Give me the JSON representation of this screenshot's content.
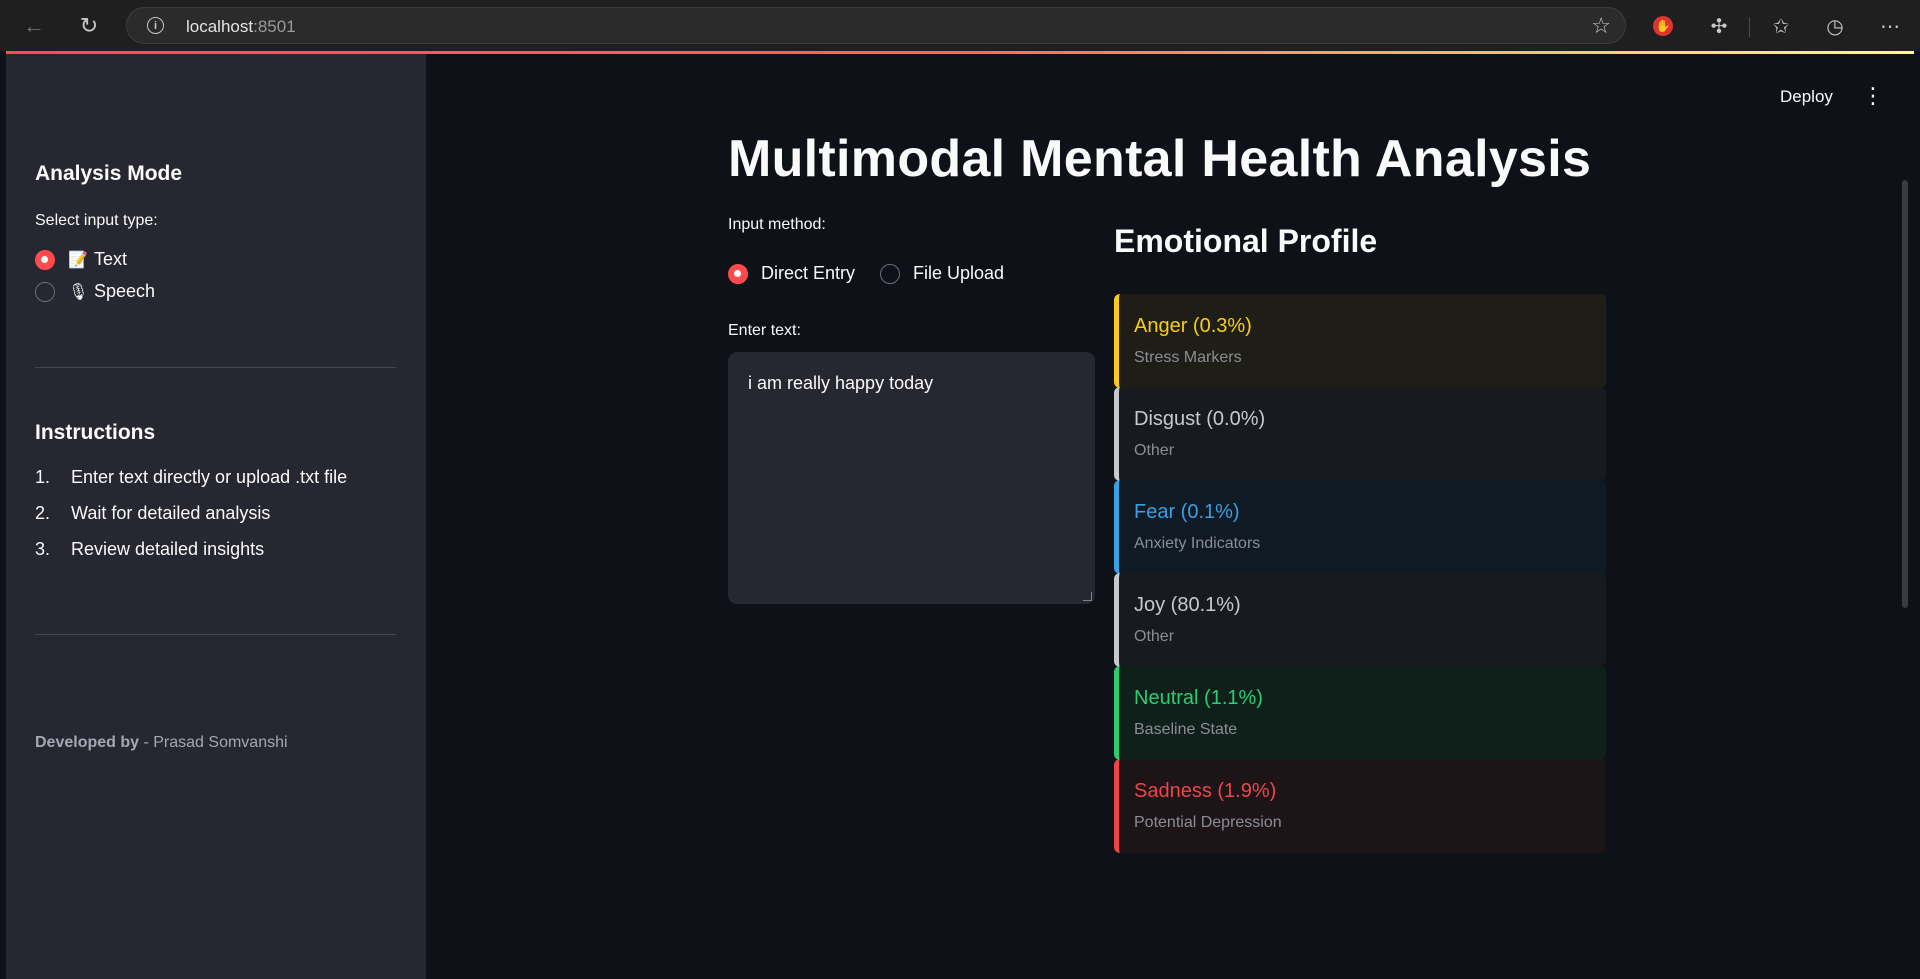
{
  "browser": {
    "url_host": "localhost",
    "url_port": ":8501",
    "colors": {
      "extension_red": "#e0332f"
    }
  },
  "sidebar": {
    "analysis_heading": "Analysis Mode",
    "select_label": "Select input type:",
    "options": [
      {
        "emoji": "📝",
        "label": "Text",
        "selected": true,
        "icon": "memo-icon"
      },
      {
        "emoji": "🎙",
        "label": "Speech",
        "selected": false,
        "icon": "microphone-icon"
      }
    ],
    "instructions_heading": "Instructions",
    "instructions": [
      {
        "num": "1.",
        "text": "Enter text directly or upload .txt file"
      },
      {
        "num": "2.",
        "text": "Wait for detailed analysis"
      },
      {
        "num": "3.",
        "text": "Review detailed insights"
      }
    ],
    "developed_by_label": "Developed by",
    "developed_by_name": " - Prasad Somvanshi"
  },
  "header": {
    "deploy_label": "Deploy",
    "menu_glyph": "⋮"
  },
  "main": {
    "title": "Multimodal Mental Health Analysis",
    "input_method_label": "Input method:",
    "input_methods": [
      {
        "label": "Direct Entry",
        "selected": true
      },
      {
        "label": "File Upload",
        "selected": false
      }
    ],
    "enter_text_label": "Enter text:",
    "text_value": "i am really happy today"
  },
  "profile": {
    "heading": "Emotional Profile",
    "emotions": [
      {
        "title": "Anger (0.3%)",
        "subtitle": "Stress Markers",
        "color": "#facc15",
        "bg": "#1e1e17"
      },
      {
        "title": "Disgust (0.0%)",
        "subtitle": "Other",
        "color": "#c7c9cf",
        "bg": "#181a20"
      },
      {
        "title": "Fear (0.1%)",
        "subtitle": "Anxiety Indicators",
        "color": "#3b9fe4",
        "bg": "#0f1a24"
      },
      {
        "title": "Joy (80.1%)",
        "subtitle": "Other",
        "color": "#c7c9cf",
        "bg": "#181a20"
      },
      {
        "title": "Neutral (1.1%)",
        "subtitle": "Baseline State",
        "color": "#2ecc71",
        "bg": "#0f1f1a"
      },
      {
        "title": "Sadness (1.9%)",
        "subtitle": "Potential Depression",
        "color": "#ef4444",
        "bg": "#1d1418"
      }
    ]
  },
  "theme": {
    "accent": "#ff4b4b",
    "background": "#0e1117",
    "sidebar_bg": "#262730"
  }
}
